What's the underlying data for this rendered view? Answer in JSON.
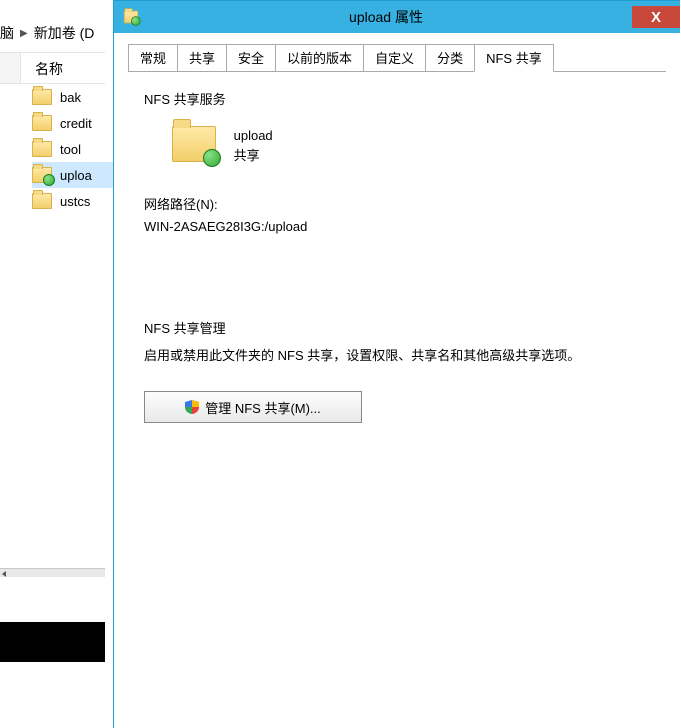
{
  "explorer": {
    "breadcrumb": {
      "seg1": "脑",
      "seg2": "新加卷 (D"
    },
    "name_header": "名称",
    "items": [
      {
        "label": "bak"
      },
      {
        "label": "credit"
      },
      {
        "label": "tool"
      },
      {
        "label": "uploa",
        "share": true,
        "selected": true
      },
      {
        "label": "ustcs"
      }
    ]
  },
  "dialog": {
    "title": "upload 属性",
    "close": "X",
    "tabs": [
      "常规",
      "共享",
      "安全",
      "以前的版本",
      "自定义",
      "分类",
      "NFS 共享"
    ],
    "active_tab": 6,
    "group1": {
      "label": "NFS 共享服务",
      "share_name": "upload",
      "share_status": "共享",
      "netpath_label": "网络路径(N):",
      "netpath_value": "WIN-2ASAEG28I3G:/upload"
    },
    "group2": {
      "label": "NFS 共享管理",
      "desc": "启用或禁用此文件夹的 NFS 共享，设置权限、共享名和其他高级共享选项。",
      "button": "管理 NFS 共享(M)..."
    }
  }
}
